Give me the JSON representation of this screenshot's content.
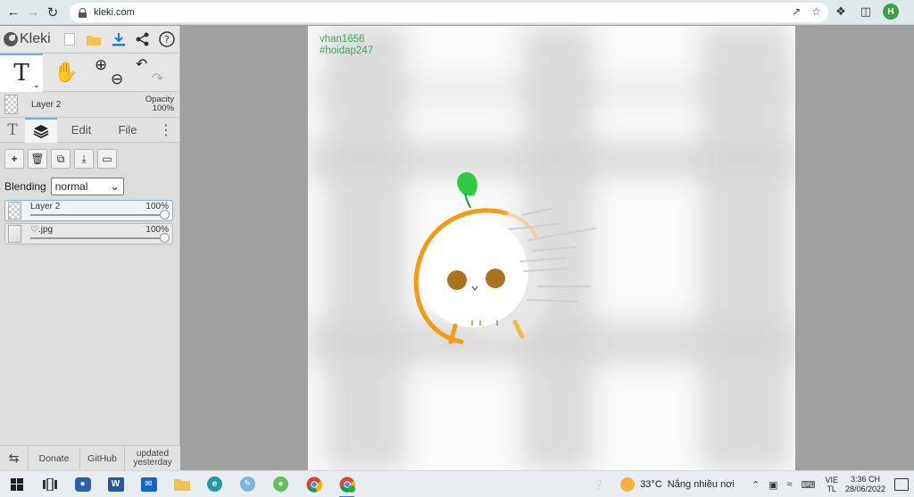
{
  "browser": {
    "url": "kleki.com",
    "profile_initial": "H"
  },
  "app": {
    "logo_text": "Kleki",
    "layer_name": "Layer 2",
    "opacity_label": "Opacity",
    "opacity_value": "100%",
    "tabs": {
      "edit": "Edit",
      "file": "File"
    },
    "blending_label": "Blending",
    "blending_value": "normal",
    "layers": [
      {
        "name": "Layer 2",
        "opacity": "100%"
      },
      {
        "name": "♡.jpg",
        "opacity": "100%"
      }
    ],
    "bottom": {
      "donate": "Donate",
      "github": "GitHub",
      "updated_line1": "updated",
      "updated_line2": "yesterday"
    }
  },
  "canvas": {
    "watermark_line1": "vhan1656",
    "watermark_line2": "#hoidap247"
  },
  "taskbar": {
    "temperature": "33°C",
    "weather": "Nắng nhiều nơi",
    "lang_line1": "VIE",
    "lang_line2": "TL",
    "time": "3:36 CH",
    "date": "28/06/2022"
  },
  "colors": {
    "accent": "#6ab0e6",
    "character_orange": "#f39c12",
    "leaf_green": "#2ecc40",
    "eye_brown": "#a8731c",
    "watermark_green": "#39a852"
  }
}
